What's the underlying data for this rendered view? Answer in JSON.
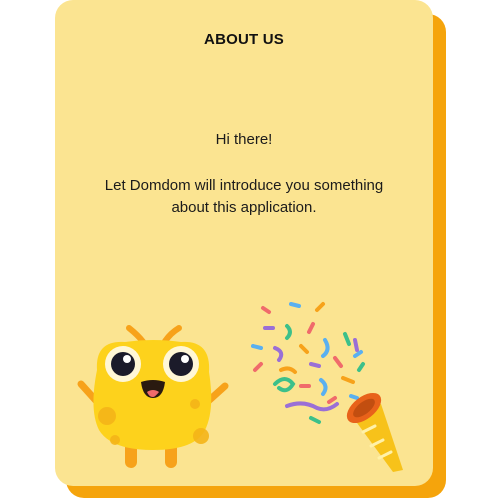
{
  "card": {
    "title": "ABOUT US",
    "greeting": "Hi there!",
    "intro": "Let Domdom will introduce you something about this application."
  },
  "colors": {
    "card_background": "#fbe491",
    "card_shadow": "#f5a40c",
    "mascot_body": "#fdd21c",
    "mascot_limbs": "#f7a21a"
  },
  "icons": {
    "mascot": "domdom-mascot-illustration",
    "party_popper": "party-popper-icon",
    "confetti": "confetti-decoration"
  }
}
